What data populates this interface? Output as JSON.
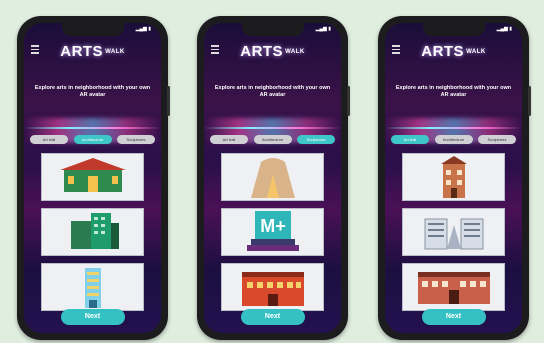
{
  "screens": [
    {
      "menu_icon": "hamburger-icon",
      "logo": {
        "main": "ARTS",
        "sub": "WALK"
      },
      "tagline": "Explore arts in neighborhood with your own AR avatar",
      "chips": [
        "Art trail",
        "Architecture",
        "Sculptures"
      ],
      "active_chip": 1,
      "cards": [
        "building-pagoda",
        "building-green",
        "building-tower"
      ],
      "next_label": "Next"
    },
    {
      "menu_icon": "hamburger-icon",
      "logo": {
        "main": "ARTS",
        "sub": "WALK"
      },
      "tagline": "Explore arts in neighborhood with your own AR avatar",
      "chips": [
        "Art trail",
        "Architecture",
        "Sculptures"
      ],
      "active_chip": 2,
      "cards": [
        "dome",
        "m-plus",
        "red-building"
      ],
      "next_label": "Next"
    },
    {
      "menu_icon": "hamburger-icon",
      "logo": {
        "main": "ARTS",
        "sub": "WALK"
      },
      "tagline": "Explore arts in neighborhood with your own AR avatar",
      "chips": [
        "Art trail",
        "Architecture",
        "Sculptures"
      ],
      "active_chip": 0,
      "cards": [
        "clock-tower",
        "modern-building",
        "long-building"
      ],
      "next_label": "Next"
    }
  ],
  "colors": {
    "accent": "#35c1c4",
    "frame": "#1c1c1e",
    "background": "#dfeede"
  }
}
